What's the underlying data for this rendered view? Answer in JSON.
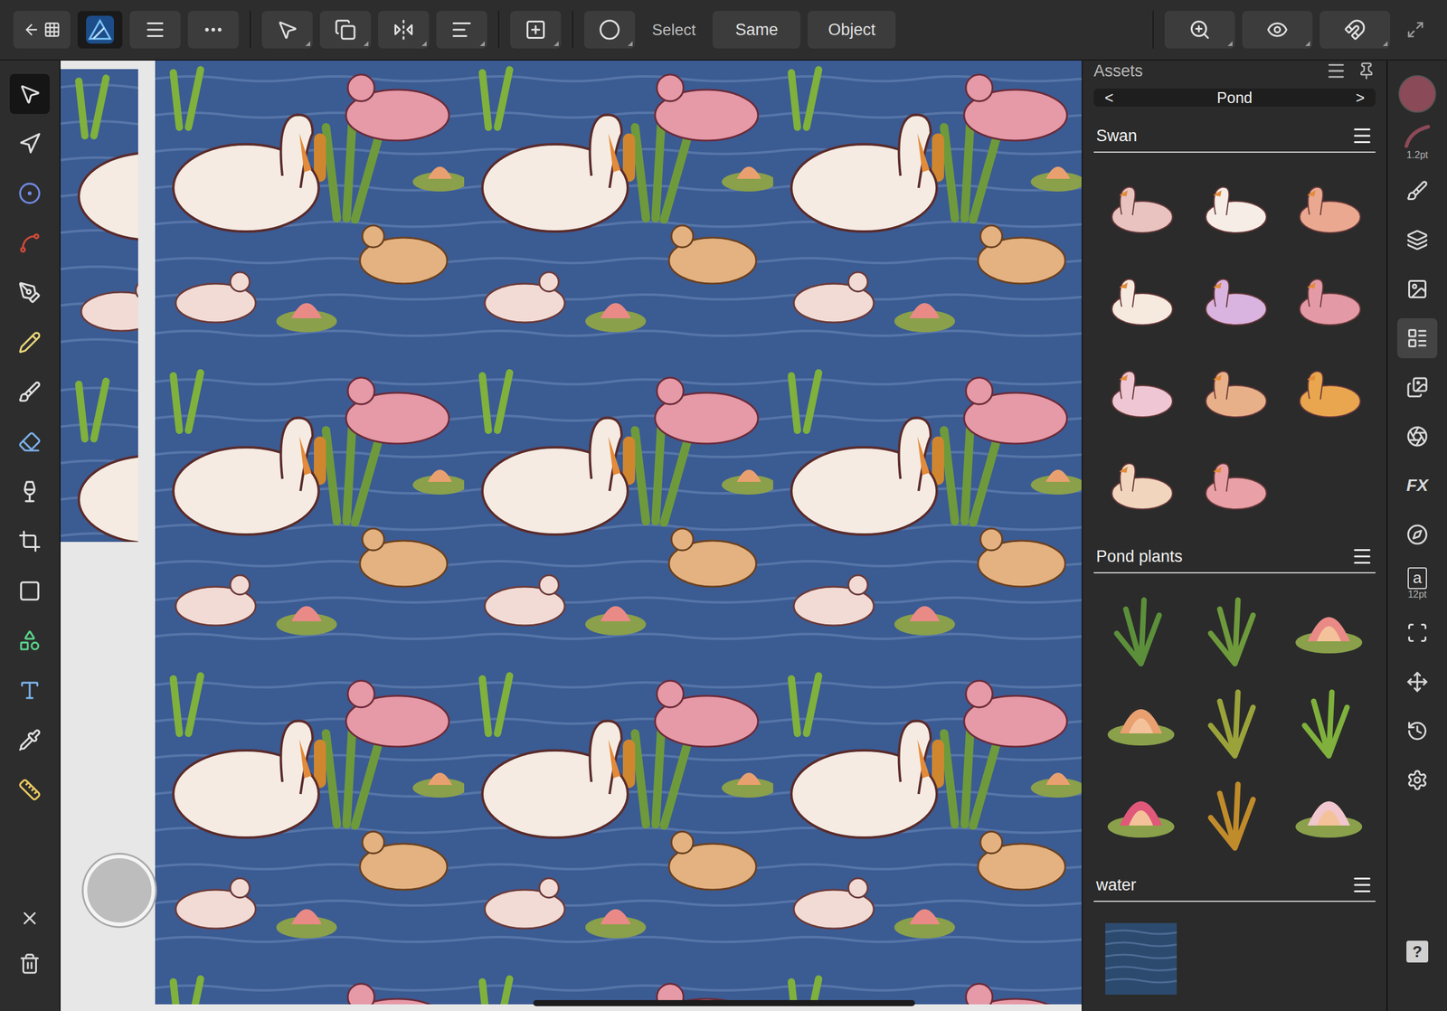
{
  "toolbar": {
    "app_button": {
      "selected": true
    },
    "move_tool": {
      "selected": true
    },
    "select_label": "Select",
    "buttons": [
      {
        "label": "Same"
      },
      {
        "label": "Object"
      }
    ]
  },
  "tools": [
    {
      "selected": true
    },
    {
      "selected": false
    },
    {
      "selected": false
    },
    {
      "selected": false
    },
    {
      "selected": false
    },
    {
      "selected": false
    },
    {
      "selected": false
    },
    {
      "selected": false
    },
    {
      "selected": false
    },
    {
      "selected": false
    },
    {
      "selected": false
    },
    {
      "selected": false
    },
    {
      "selected": false
    },
    {
      "selected": false
    },
    {
      "selected": false
    }
  ],
  "assets": {
    "title": "Assets",
    "category": {
      "prev": "<",
      "label": "Pond",
      "next": ">"
    },
    "sections": [
      {
        "title": "Swan",
        "items": [
          {
            "kind": "bird",
            "color": "#e8c3c0"
          },
          {
            "kind": "bird",
            "color": "#f5ede6"
          },
          {
            "kind": "bird",
            "color": "#e9a88f"
          },
          {
            "kind": "bird",
            "color": "#f6eadf"
          },
          {
            "kind": "bird",
            "color": "#d9b4e0"
          },
          {
            "kind": "bird",
            "color": "#e39aa6"
          },
          {
            "kind": "bird",
            "color": "#eec6d4"
          },
          {
            "kind": "bird",
            "color": "#e7b089"
          },
          {
            "kind": "bird",
            "color": "#e9a64f"
          },
          {
            "kind": "bird",
            "color": "#f1d6bd"
          },
          {
            "kind": "bird",
            "color": "#e9a0a6"
          }
        ]
      },
      {
        "title": "Pond plants",
        "items": [
          {
            "kind": "plant",
            "color": "#5c8f3a"
          },
          {
            "kind": "plant",
            "color": "#6e9a3c"
          },
          {
            "kind": "lotus",
            "color": "#e98a86"
          },
          {
            "kind": "lotus",
            "color": "#e9a070"
          },
          {
            "kind": "plant",
            "color": "#9aa33a"
          },
          {
            "kind": "plant",
            "color": "#7fb13c"
          },
          {
            "kind": "lotus",
            "color": "#e0587a"
          },
          {
            "kind": "plant",
            "color": "#c08b2a"
          },
          {
            "kind": "lotus",
            "color": "#f1c7cf"
          }
        ]
      },
      {
        "title": "water",
        "items": [
          {
            "kind": "water",
            "color": "#2c4a6e"
          }
        ]
      }
    ]
  },
  "right_strip": {
    "color": "#8b4a57",
    "stroke_width": "1.2pt",
    "panels": [
      {
        "kind": "icon",
        "selected": false
      },
      {
        "kind": "icon",
        "selected": false
      },
      {
        "kind": "icon",
        "selected": false
      },
      {
        "kind": "icon",
        "selected": true
      },
      {
        "kind": "icon",
        "selected": false
      },
      {
        "kind": "icon",
        "selected": false
      },
      {
        "kind": "label",
        "label": "FX",
        "selected": false
      },
      {
        "kind": "icon",
        "selected": false
      },
      {
        "kind": "text",
        "glyph": "a",
        "size": "12pt",
        "selected": false
      },
      {
        "kind": "icon",
        "selected": false
      },
      {
        "kind": "icon",
        "selected": false
      },
      {
        "kind": "icon",
        "selected": false
      },
      {
        "kind": "icon",
        "selected": false
      }
    ],
    "help": "?"
  }
}
